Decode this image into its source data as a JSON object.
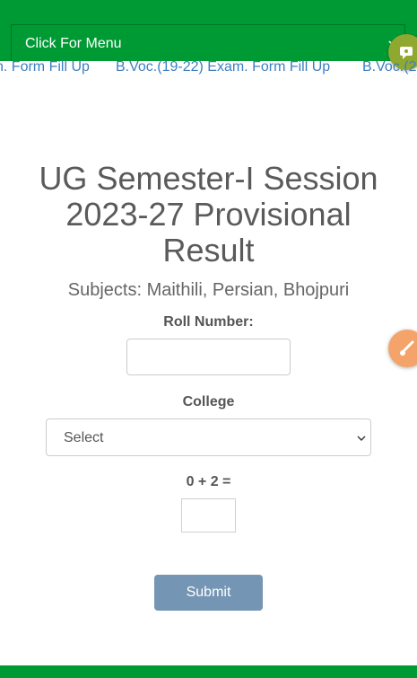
{
  "header": {
    "menu_toggle_label": "Click For Menu"
  },
  "marquee": {
    "items": [
      "n. Form Fill Up",
      "B.Voc.(19-22) Exam. Form Fill Up",
      "B.Voc.(2"
    ]
  },
  "page": {
    "title": "UG Semester-I Session 2023-27 Provisional Result",
    "subtitle": "Subjects: Maithili, Persian, Bhojpuri"
  },
  "form": {
    "roll_label": "Roll Number:",
    "roll_value": "",
    "college_label": "College",
    "college_selected": "Select",
    "captcha_question": "0 + 2 =",
    "captcha_value": "",
    "submit_label": "Submit"
  },
  "colors": {
    "brand_green": "#009a35",
    "link_blue": "#3d7fbf",
    "submit_bg": "#7595b4",
    "float_olive": "#8fa82f",
    "float_orange": "#f4a46b"
  },
  "icons": {
    "menu_toggle": "chevron-down-icon",
    "select": "chevron-down-icon",
    "float_top": "chat-icon",
    "float_side": "paintbrush-icon"
  }
}
